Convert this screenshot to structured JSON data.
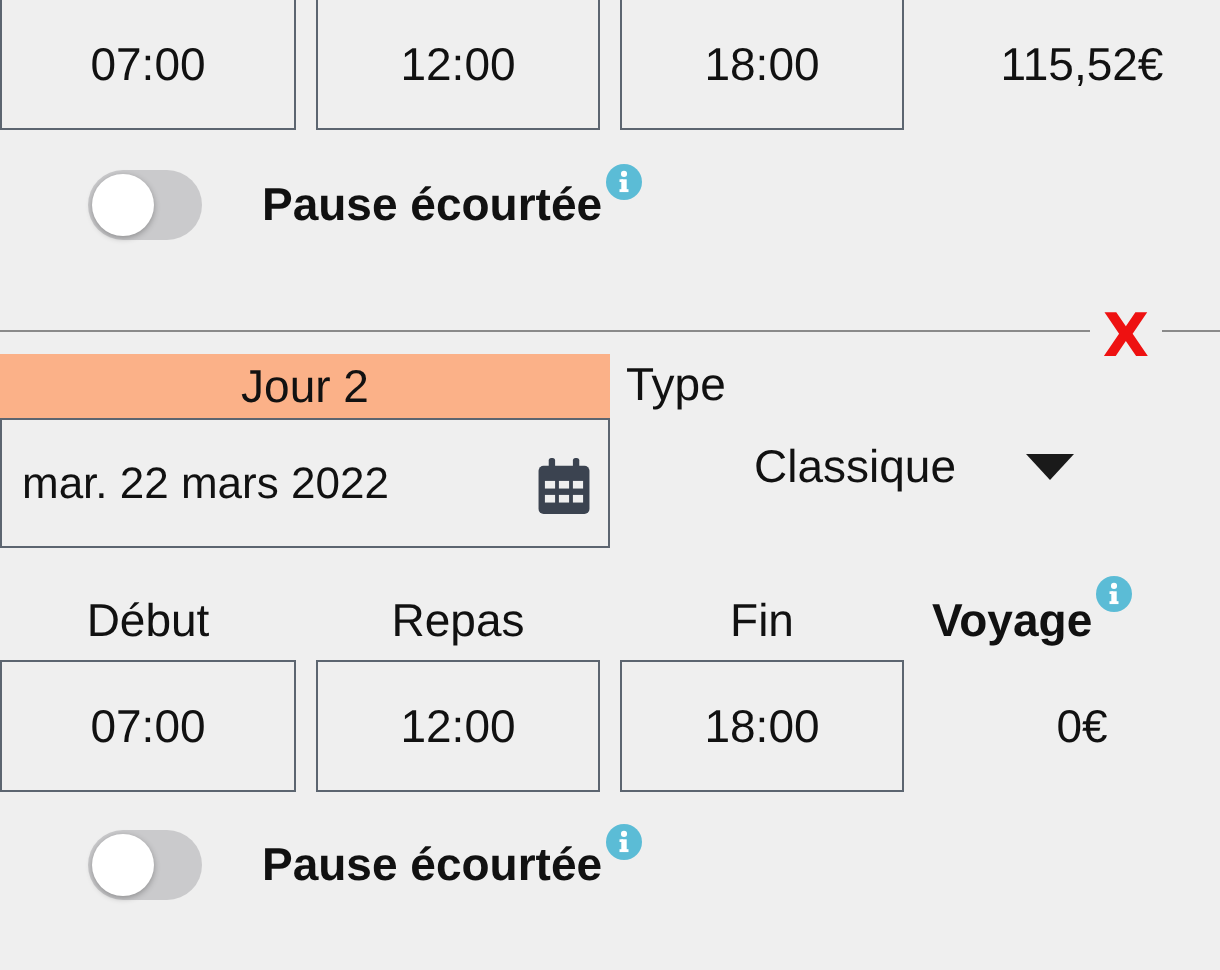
{
  "first_day": {
    "times": [
      "07:00",
      "12:00",
      "18:00"
    ],
    "travel_amount": "115,52€",
    "pause": {
      "label": "Pause écourtée",
      "on": false
    }
  },
  "delete_mark": "X",
  "second_day": {
    "title": "Jour 2",
    "type_label": "Type",
    "date": "mar. 22 mars 2022",
    "type_value": "Classique",
    "columns": [
      "Début",
      "Repas",
      "Fin",
      "Voyage"
    ],
    "times": [
      "07:00",
      "12:00",
      "18:00"
    ],
    "travel_amount": "0€",
    "pause": {
      "label": "Pause écourtée",
      "on": false
    }
  }
}
